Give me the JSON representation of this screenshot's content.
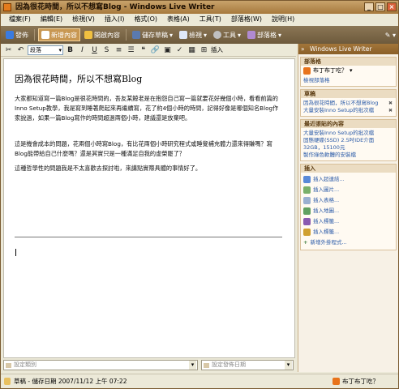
{
  "window": {
    "title": "因為很花時間，所以不想寫Blog - Windows Live Writer"
  },
  "menu": [
    "檔案(F)",
    "編輯(E)",
    "檢視(V)",
    "插入(I)",
    "格式(O)",
    "表格(A)",
    "工具(T)",
    "部落格(W)",
    "說明(H)"
  ],
  "toolbar": {
    "publish": "發佈",
    "new": "新增內容",
    "open": "開啟內容",
    "save": "儲存草稿",
    "view": "檢視",
    "tools": "工具",
    "blogs": "部落格"
  },
  "format": {
    "style": "段落",
    "insert": "插入"
  },
  "post": {
    "title": "因為很花時間，所以不想寫Blog",
    "p1": "大家都知道寫一篇Blog是很花時間的，吾友某鯨老是在抱怨自己寫一篇就要花好幾個小時，看看前篇的Inno Setup教學，我是寫到睡著爬起來再繼續寫，花了約4個小時的時間，記得好像是哪個知名Blog作家說過，如果一篇Blog寫作的時間超過兩個小時，建議還是放棄吧。",
    "p2": "這是機會成本的問題，花兩個小時寫Blog，有比花兩個小時研究程式或睡覺補充體力還來得賺嗎？寫Blog能帶給自己什麼嗎？還是其實只是一種滿足自我的虛榮罷了？",
    "p3": "這種哲學性的問題我是不太喜歡去探討啦，來講點實際具體的事情好了。"
  },
  "fields": {
    "category_placeholder": "設定類別",
    "date_placeholder": "設定發佈日期"
  },
  "sidebar": {
    "header": "Windows Live Writer",
    "blog_section": "部落格",
    "blog_name": "布丁布丁吃？",
    "view_blog": "檢視部落格",
    "drafts_section": "草稿",
    "drafts": [
      "因為很花時間，所以不想寫Blog",
      "大量安裝Inno Setup的批次檔"
    ],
    "recent_section": "最近張貼的內容",
    "recent": [
      "大量安裝Inno Setup的批次檔",
      "固態硬碟(SSD) 2.5吋IDE介面32GB，15100元",
      "製作綠色軟體的安裝檔"
    ],
    "insert_section": "插入",
    "inserts": [
      "插入超連結...",
      "插入圖片...",
      "插入表格...",
      "插入地圖...",
      "插入標籤...",
      "插入標籤..."
    ],
    "add_plugin": "新增外掛程式..."
  },
  "status": {
    "text": "草稿 - 儲存日期 2007/11/12 上午 07:22",
    "blog": "布丁布丁吃？"
  },
  "colors": {
    "accent": "#a7793d",
    "link": "#2a5aa8",
    "blog_icon": "#e8731b"
  }
}
